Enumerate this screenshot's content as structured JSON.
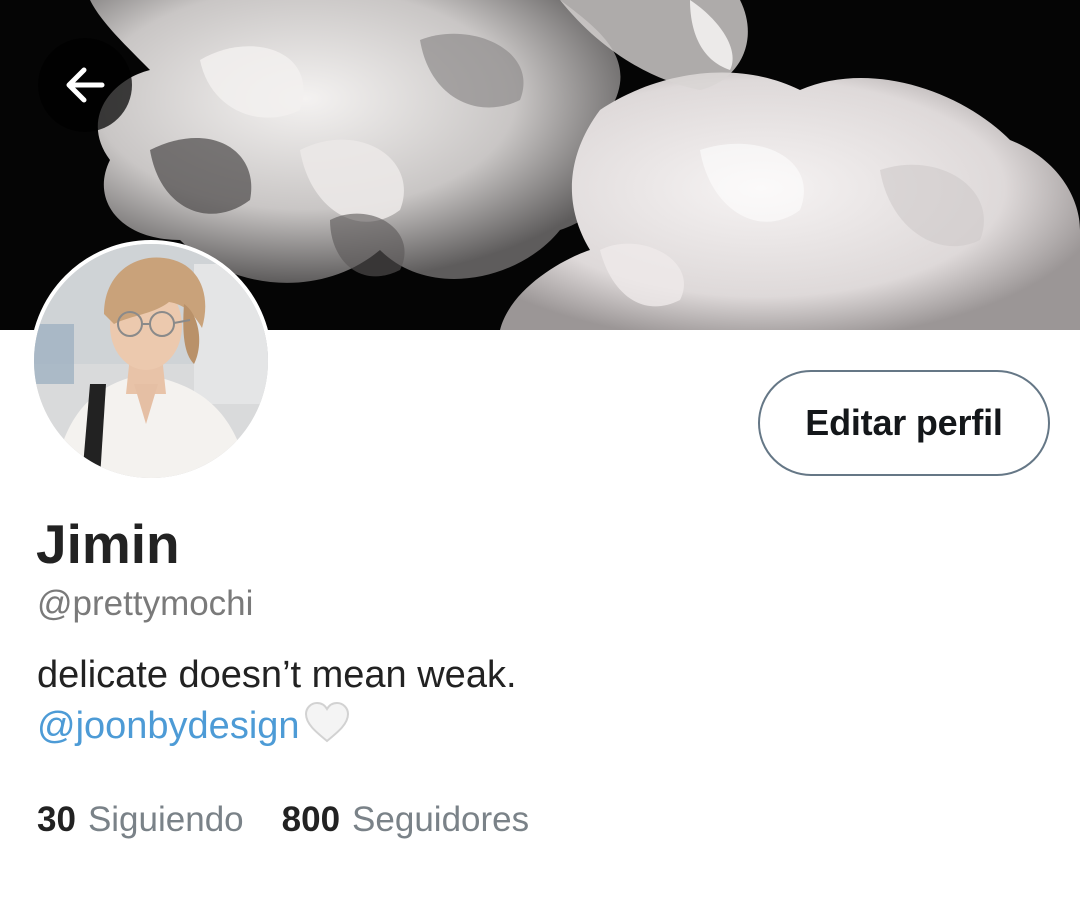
{
  "profile": {
    "name": "Jimin",
    "handle": "@prettymochi",
    "bio_text": "delicate doesn’t mean weak.",
    "bio_mention": "@joonbydesign",
    "bio_emoji": "white-heart-icon"
  },
  "actions": {
    "edit_label": "Editar perfil",
    "back_icon": "back-arrow-icon"
  },
  "stats": {
    "following_count": "30",
    "following_label": "Siguiendo",
    "followers_count": "800",
    "followers_label": "Seguidores"
  },
  "colors": {
    "link": "#4d9bd6",
    "banner_bg": "#050505",
    "muted_text": "#7a7a7a"
  }
}
